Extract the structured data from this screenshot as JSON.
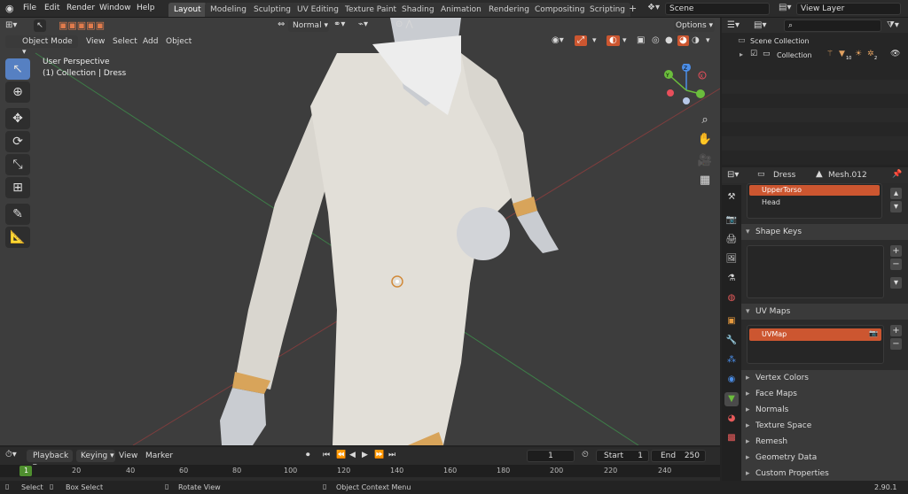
{
  "menus": [
    "File",
    "Edit",
    "Render",
    "Window",
    "Help"
  ],
  "workspaces": [
    "Layout",
    "Modeling",
    "Sculpting",
    "UV Editing",
    "Texture Paint",
    "Shading",
    "Animation",
    "Rendering",
    "Compositing",
    "Scripting"
  ],
  "active_workspace": "Layout",
  "scene": "Scene",
  "view_layer": "View Layer",
  "viewport": {
    "orientation": "Normal",
    "options": "Options",
    "mode": "Object Mode",
    "menus": [
      "View",
      "Select",
      "Add",
      "Object"
    ],
    "overlay_title": "User Perspective",
    "overlay_sub": "(1) Collection | Dress",
    "gizmo_axes": [
      "X",
      "Y",
      "Z"
    ]
  },
  "outliner": {
    "scene_collection": "Scene Collection",
    "collection": "Collection",
    "badge_a": "10",
    "badge_b": "2"
  },
  "properties": {
    "object_name": "Dress",
    "mesh_name": "Mesh.012",
    "vertex_groups": [
      "UpperTorso",
      "Head"
    ],
    "shape_keys_title": "Shape Keys",
    "uv_maps_title": "UV Maps",
    "uv_map": "UVMap",
    "panels": [
      "Vertex Colors",
      "Face Maps",
      "Normals",
      "Texture Space",
      "Remesh",
      "Geometry Data",
      "Custom Properties"
    ]
  },
  "timeline": {
    "playback": "Playback",
    "keying": "Keying",
    "view": "View",
    "marker": "Marker",
    "current_frame": "1",
    "start_label": "Start",
    "start": "1",
    "end_label": "End",
    "end": "250",
    "ticks": [
      "1",
      "20",
      "40",
      "60",
      "80",
      "100",
      "120",
      "140",
      "160",
      "180",
      "200",
      "220",
      "240"
    ]
  },
  "status": {
    "select": "Select",
    "box_select": "Box Select",
    "rotate_view": "Rotate View",
    "context_menu": "Object Context Menu",
    "version": "2.90.1"
  },
  "colors": {
    "accent": "#cc5630",
    "active_tool": "#5680c2",
    "x_axis": "#e84f5b",
    "y_axis": "#6bbd3c",
    "z_axis": "#4b8ee8"
  }
}
